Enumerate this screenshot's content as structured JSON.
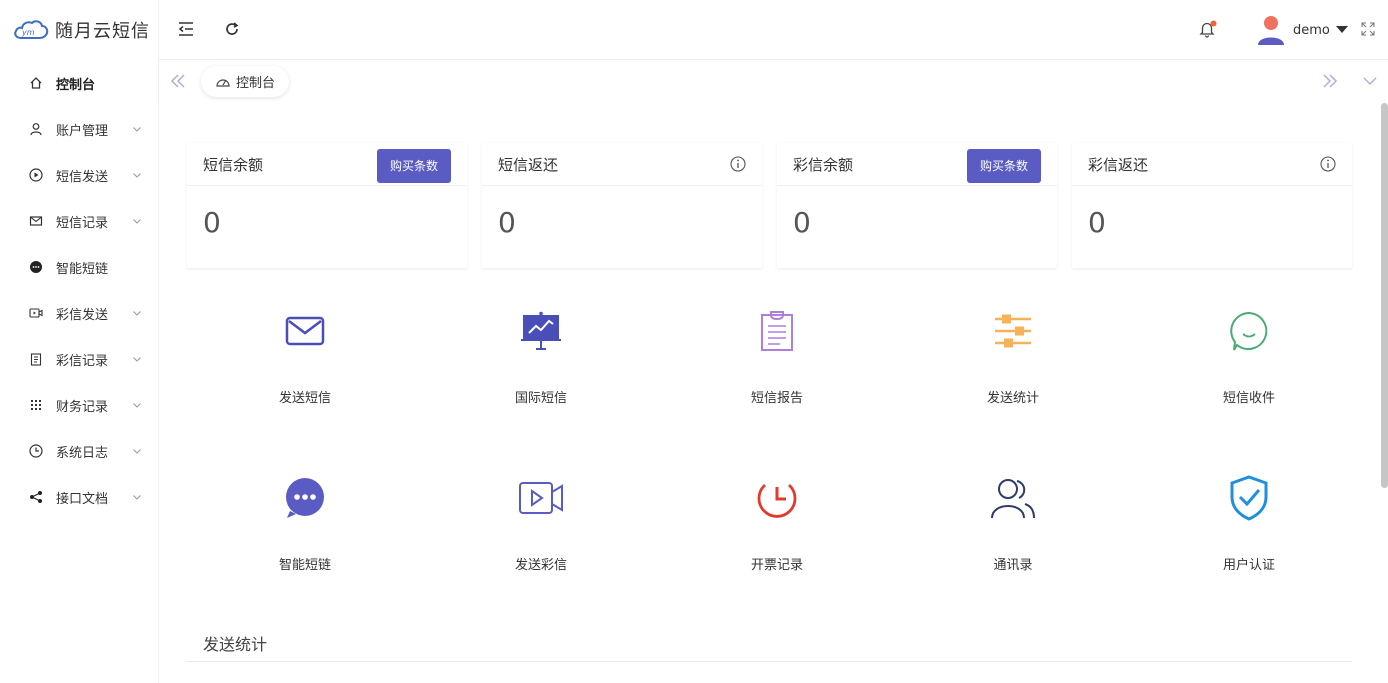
{
  "brand": {
    "name": "随月云短信",
    "logo_mark": "ym"
  },
  "sidebar": {
    "items": [
      {
        "label": "控制台",
        "icon": "home-icon",
        "active": true,
        "has_children": false
      },
      {
        "label": "账户管理",
        "icon": "user-icon",
        "has_children": true
      },
      {
        "label": "短信发送",
        "icon": "play-circle-icon",
        "has_children": true
      },
      {
        "label": "短信记录",
        "icon": "mail-icon",
        "has_children": true
      },
      {
        "label": "智能短链",
        "icon": "chat-bubble-icon",
        "has_children": false
      },
      {
        "label": "彩信发送",
        "icon": "video-icon",
        "has_children": true
      },
      {
        "label": "彩信记录",
        "icon": "clipboard-icon",
        "has_children": true
      },
      {
        "label": "财务记录",
        "icon": "grid-icon",
        "has_children": true
      },
      {
        "label": "系统日志",
        "icon": "clock-icon",
        "has_children": true
      },
      {
        "label": "接口文档",
        "icon": "share-icon",
        "has_children": true
      }
    ]
  },
  "header": {
    "user_name": "demo",
    "notification_dot": true
  },
  "tabs": [
    {
      "label": "控制台",
      "icon": "dashboard-icon"
    }
  ],
  "cards": [
    {
      "title": "短信余额",
      "value": "0",
      "action": "购买条数"
    },
    {
      "title": "短信返还",
      "value": "0",
      "action": null
    },
    {
      "title": "彩信余额",
      "value": "0",
      "action": "购买条数"
    },
    {
      "title": "彩信返还",
      "value": "0",
      "action": null
    }
  ],
  "shortcuts": [
    {
      "label": "发送短信",
      "icon": "envelope-icon"
    },
    {
      "label": "国际短信",
      "icon": "presentation-icon"
    },
    {
      "label": "短信报告",
      "icon": "report-icon"
    },
    {
      "label": "发送统计",
      "icon": "sliders-icon"
    },
    {
      "label": "短信收件",
      "icon": "smile-chat-icon"
    },
    {
      "label": "智能短链",
      "icon": "chat-dots-icon"
    },
    {
      "label": "发送彩信",
      "icon": "video-play-icon"
    },
    {
      "label": "开票记录",
      "icon": "alarm-clock-icon"
    },
    {
      "label": "通讯录",
      "icon": "contacts-icon"
    },
    {
      "label": "用户认证",
      "icon": "shield-check-icon"
    }
  ],
  "section": {
    "title": "发送统计"
  },
  "colors": {
    "primary": "#5a5bc3",
    "notification": "#f0652f",
    "avatar_head": "#f07160",
    "avatar_body": "#5a5bc3"
  }
}
